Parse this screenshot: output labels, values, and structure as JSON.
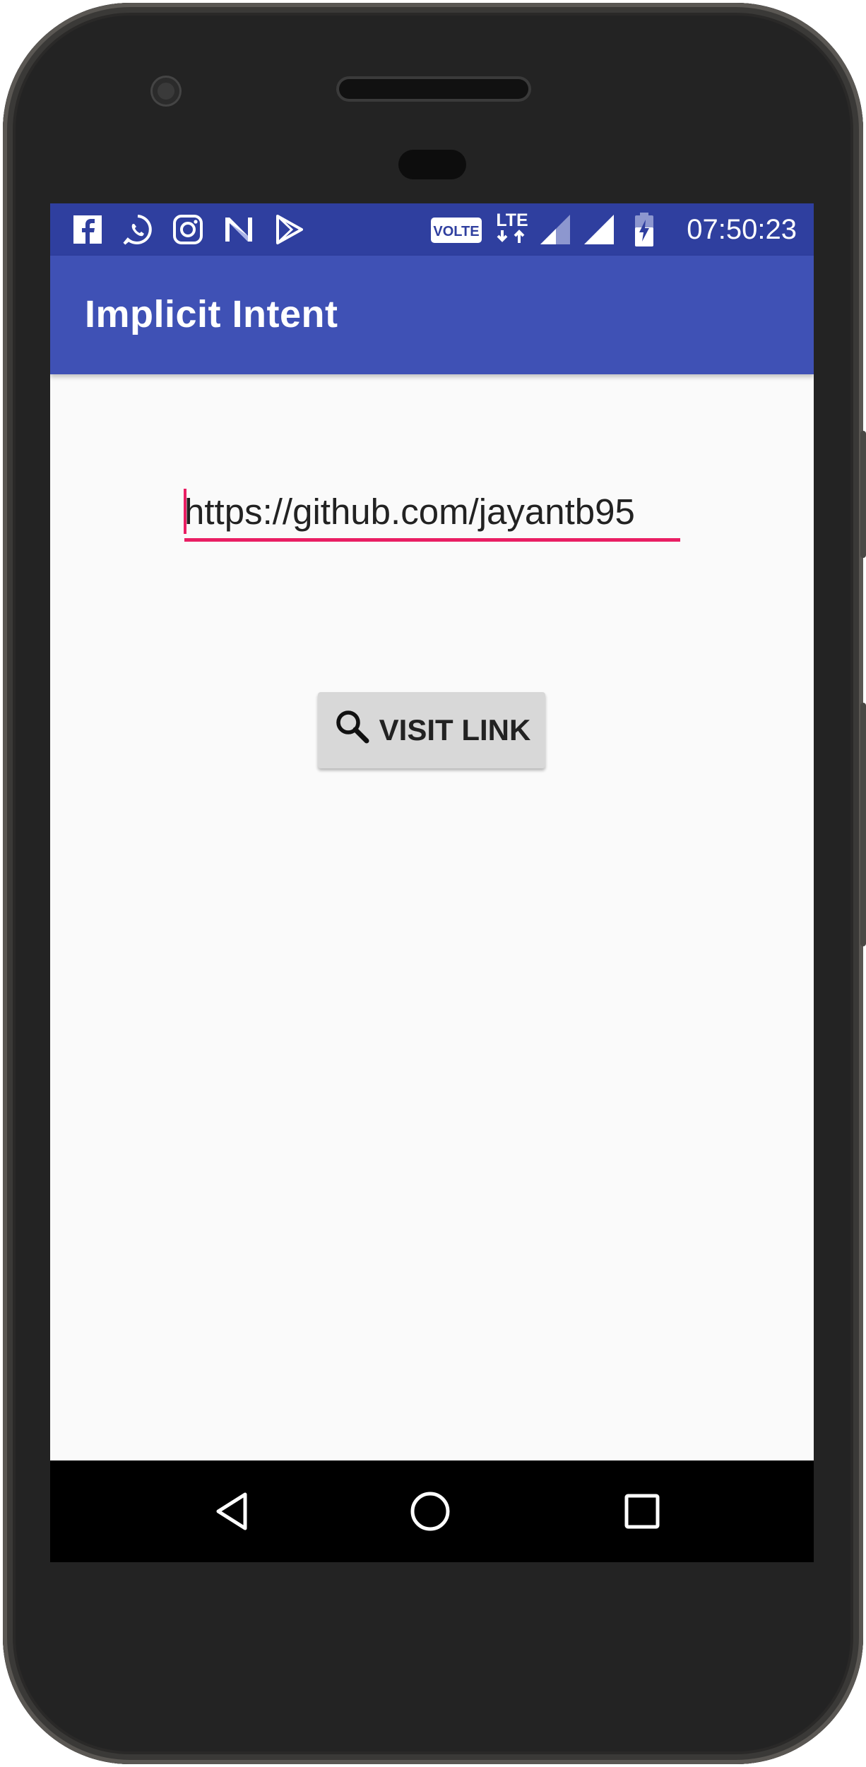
{
  "status_bar": {
    "time": "07:50:23",
    "volte_label": "VOLTE",
    "lte_label": "LTE",
    "notification_icons": [
      "facebook-icon",
      "whatsapp-icon",
      "instagram-icon",
      "n-app-icon",
      "play-store-icon"
    ],
    "system_icons": [
      "volte-icon",
      "lte-icon",
      "signal-1-icon",
      "signal-2-icon",
      "battery-charging-icon"
    ]
  },
  "app_bar": {
    "title": "Implicit Intent"
  },
  "url_field": {
    "value": "https://github.com/jayantb95"
  },
  "visit_button": {
    "label": "VISIT LINK",
    "icon": "search-icon"
  },
  "nav_bar": {
    "buttons": [
      "back-icon",
      "home-icon",
      "recents-icon"
    ]
  },
  "colors": {
    "status_bar": "#2f3f9f",
    "primary": "#3f51b5",
    "accent": "#e91e63",
    "screen_bg": "#fafafa",
    "button_bg": "#d8d8d8"
  }
}
